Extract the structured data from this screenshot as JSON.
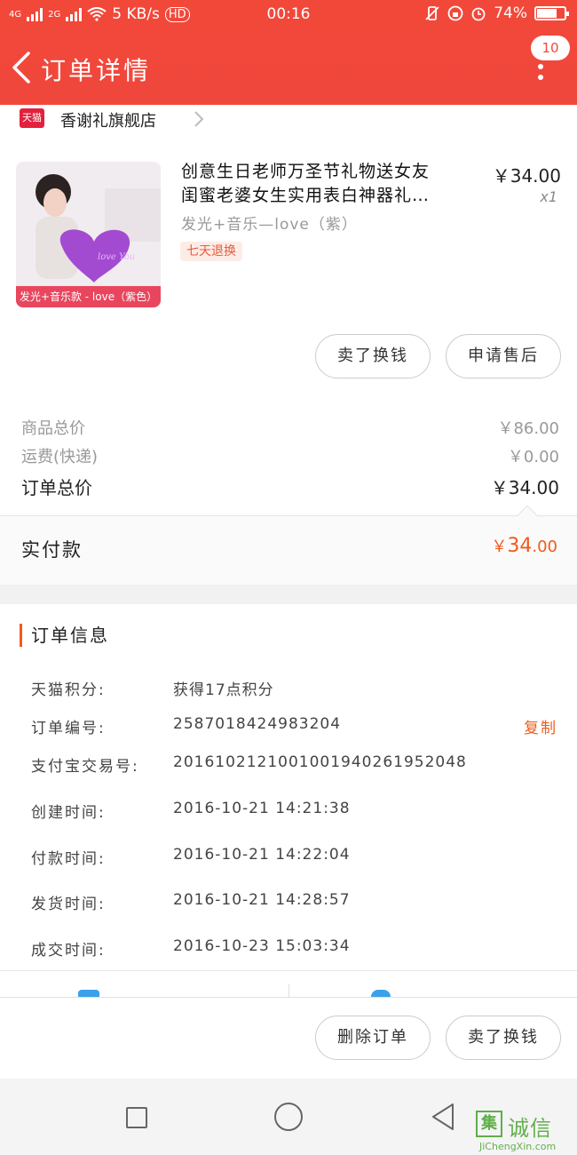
{
  "status_bar": {
    "network_left": "4G",
    "network_right": "2G",
    "speed": "5 KB/s",
    "hd": "HD",
    "time": "00:16",
    "battery": "74%"
  },
  "header": {
    "title": "订单详情",
    "badge": "10"
  },
  "shop": {
    "logo_text": "天猫",
    "name": "香谢礼旗舰店"
  },
  "product": {
    "title_line1": "创意生日老师万圣节礼物送女友",
    "title_line2": "闺蜜老婆女生实用表白神器礼…",
    "price": "￥34.00",
    "quantity": "x1",
    "sku": "发光+音乐—love（紫）",
    "tag": "七天退换",
    "image_caption": "发光+音乐款 - love（紫色）",
    "image_heart_text": "love You"
  },
  "actions": {
    "sell_label": "卖了换钱",
    "aftersale_label": "申请售后"
  },
  "summary": {
    "goods_total_label": "商品总价",
    "goods_total_value": "￥86.00",
    "shipping_label": "运费(快递)",
    "shipping_value": "￥0.00",
    "order_total_label": "订单总价",
    "order_total_value": "￥34.00",
    "paid_label": "实付款",
    "paid_currency": "￥",
    "paid_int": "34",
    "paid_dec": ".00"
  },
  "order_info": {
    "title": "订单信息",
    "copy_label": "复制",
    "rows": [
      {
        "label": "天猫积分:",
        "value": "获得17点积分"
      },
      {
        "label": "订单编号:",
        "value": "2587018424983204"
      },
      {
        "label": "支付宝交易号:",
        "value": "2016102121001001940261952048"
      },
      {
        "label": "创建时间:",
        "value": "2016-10-21 14:21:38"
      },
      {
        "label": "付款时间:",
        "value": "2016-10-21 14:22:04"
      },
      {
        "label": "发货时间:",
        "value": "2016-10-21 14:28:57"
      },
      {
        "label": "成交时间:",
        "value": "2016-10-23 15:03:34"
      }
    ]
  },
  "bottom": {
    "delete_label": "删除订单",
    "sell_label": "卖了换钱"
  },
  "watermark": {
    "mark": "集",
    "cn": "诚信",
    "en": "JiChengXin.com"
  },
  "colors": {
    "header": "#f0473c",
    "accent": "#f25a1a",
    "tmall": "#e4213d"
  }
}
